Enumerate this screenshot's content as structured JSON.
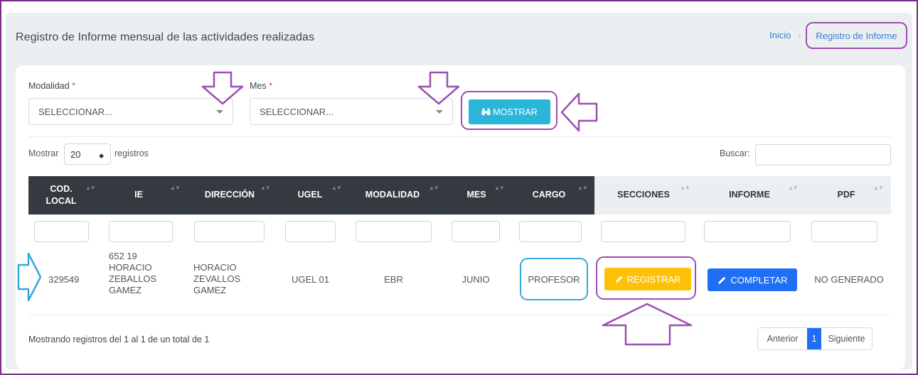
{
  "header": {
    "title": "Registro de Informe mensual de las actividades realizadas",
    "breadcrumb": {
      "home": "Inicio",
      "separator": "›",
      "current": "Registro de Informe"
    }
  },
  "filters": {
    "modalidad": {
      "label": "Modalidad",
      "required_mark": "*",
      "value": "SELECCIONAR..."
    },
    "mes": {
      "label": "Mes",
      "required_mark": "*",
      "value": "SELECCIONAR..."
    },
    "show_button": "MOSTRAR"
  },
  "table_controls": {
    "length_prefix": "Mostrar",
    "length_value": "20",
    "length_suffix": "registros",
    "search_label": "Buscar:",
    "search_value": ""
  },
  "table": {
    "columns": [
      "COD. LOCAL",
      "IE",
      "DIRECCIÓN",
      "UGEL",
      "MODALIDAD",
      "MES",
      "CARGO",
      "SECCIONES",
      "INFORME",
      "PDF"
    ],
    "rows": [
      {
        "cod_local": "329549",
        "ie": "652 19 HORACIO ZEBALLOS GAMEZ",
        "direccion": "HORACIO ZEVALLOS GAMEZ",
        "ugel": "UGEL 01",
        "modalidad": "EBR",
        "mes": "JUNIO",
        "cargo": "PROFESOR",
        "secciones_button": "REGISTRAR",
        "informe_button": "COMPLETAR",
        "pdf": "NO GENERADO"
      }
    ]
  },
  "footer": {
    "info": "Mostrando registros del 1 al 1 de un total de 1",
    "pagination": {
      "previous": "Anterior",
      "current": "1",
      "next": "Siguiente"
    }
  },
  "colors": {
    "annotation_purple": "#9b4fb0",
    "annotation_blue": "#34a8d8",
    "primary": "#1e6ff5",
    "info": "#29b6d8",
    "warning": "#ffc107",
    "dark_header": "#343a40"
  },
  "icons": {
    "show": "binoculars-icon",
    "edit": "pencil-icon",
    "dropdown": "caret-down-icon"
  }
}
